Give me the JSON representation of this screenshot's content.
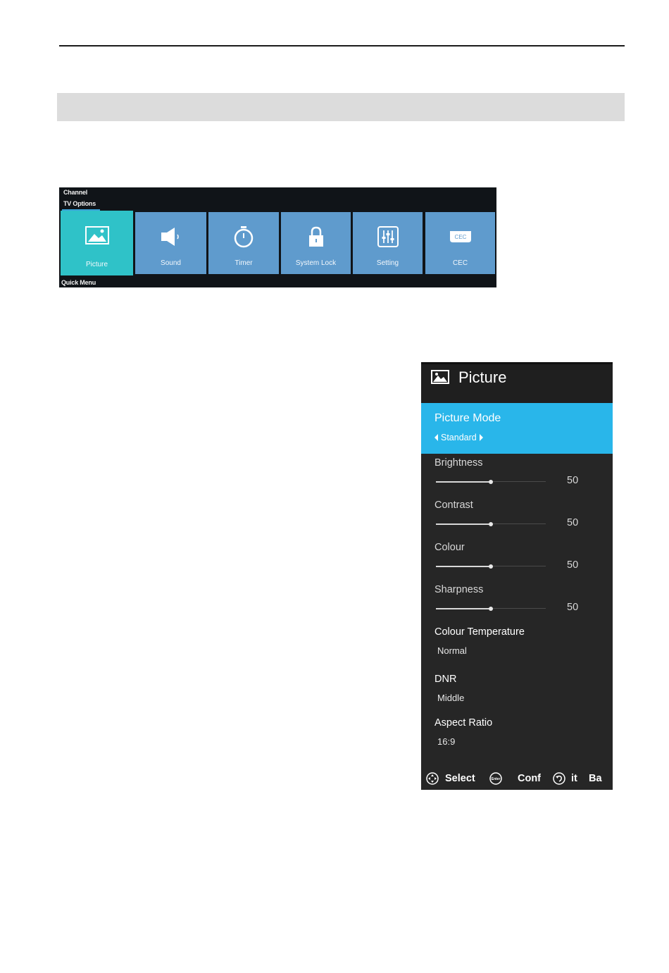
{
  "tv_options_menu": {
    "breadcrumb_top": "Channel",
    "breadcrumb_current": "TV Options",
    "bottom_label": "Quick Menu",
    "active_color": "#2fc2c8",
    "tile_color": "#5f9bcd",
    "tiles": [
      {
        "label": "Picture",
        "icon": "picture-icon"
      },
      {
        "label": "Sound",
        "icon": "speaker-icon"
      },
      {
        "label": "Timer",
        "icon": "stopwatch-icon"
      },
      {
        "label": "System Lock",
        "icon": "lock-icon"
      },
      {
        "label": "Setting",
        "icon": "sliders-icon"
      },
      {
        "label": "CEC",
        "icon": "cec-icon",
        "icon_text": "CEC"
      }
    ]
  },
  "picture_menu": {
    "title": "Picture",
    "accent_color": "#29b6ea",
    "picture_mode": {
      "label": "Picture Mode",
      "value": "Standard"
    },
    "sliders": [
      {
        "label": "Brightness",
        "value": "50",
        "fill": 0.5
      },
      {
        "label": "Contrast",
        "value": "50",
        "fill": 0.5
      },
      {
        "label": "Colour",
        "value": "50",
        "fill": 0.5
      },
      {
        "label": "Sharpness",
        "value": "50",
        "fill": 0.5
      }
    ],
    "options": [
      {
        "label": "Colour Temperature",
        "value": "Normal"
      },
      {
        "label": "DNR",
        "value": "Middle"
      },
      {
        "label": "Aspect Ratio",
        "value": "16:9"
      }
    ],
    "footer": {
      "select": "Select",
      "enter_icon_text": "Enter",
      "confirm": "Conf",
      "exit": "it",
      "back": "Ba"
    }
  }
}
